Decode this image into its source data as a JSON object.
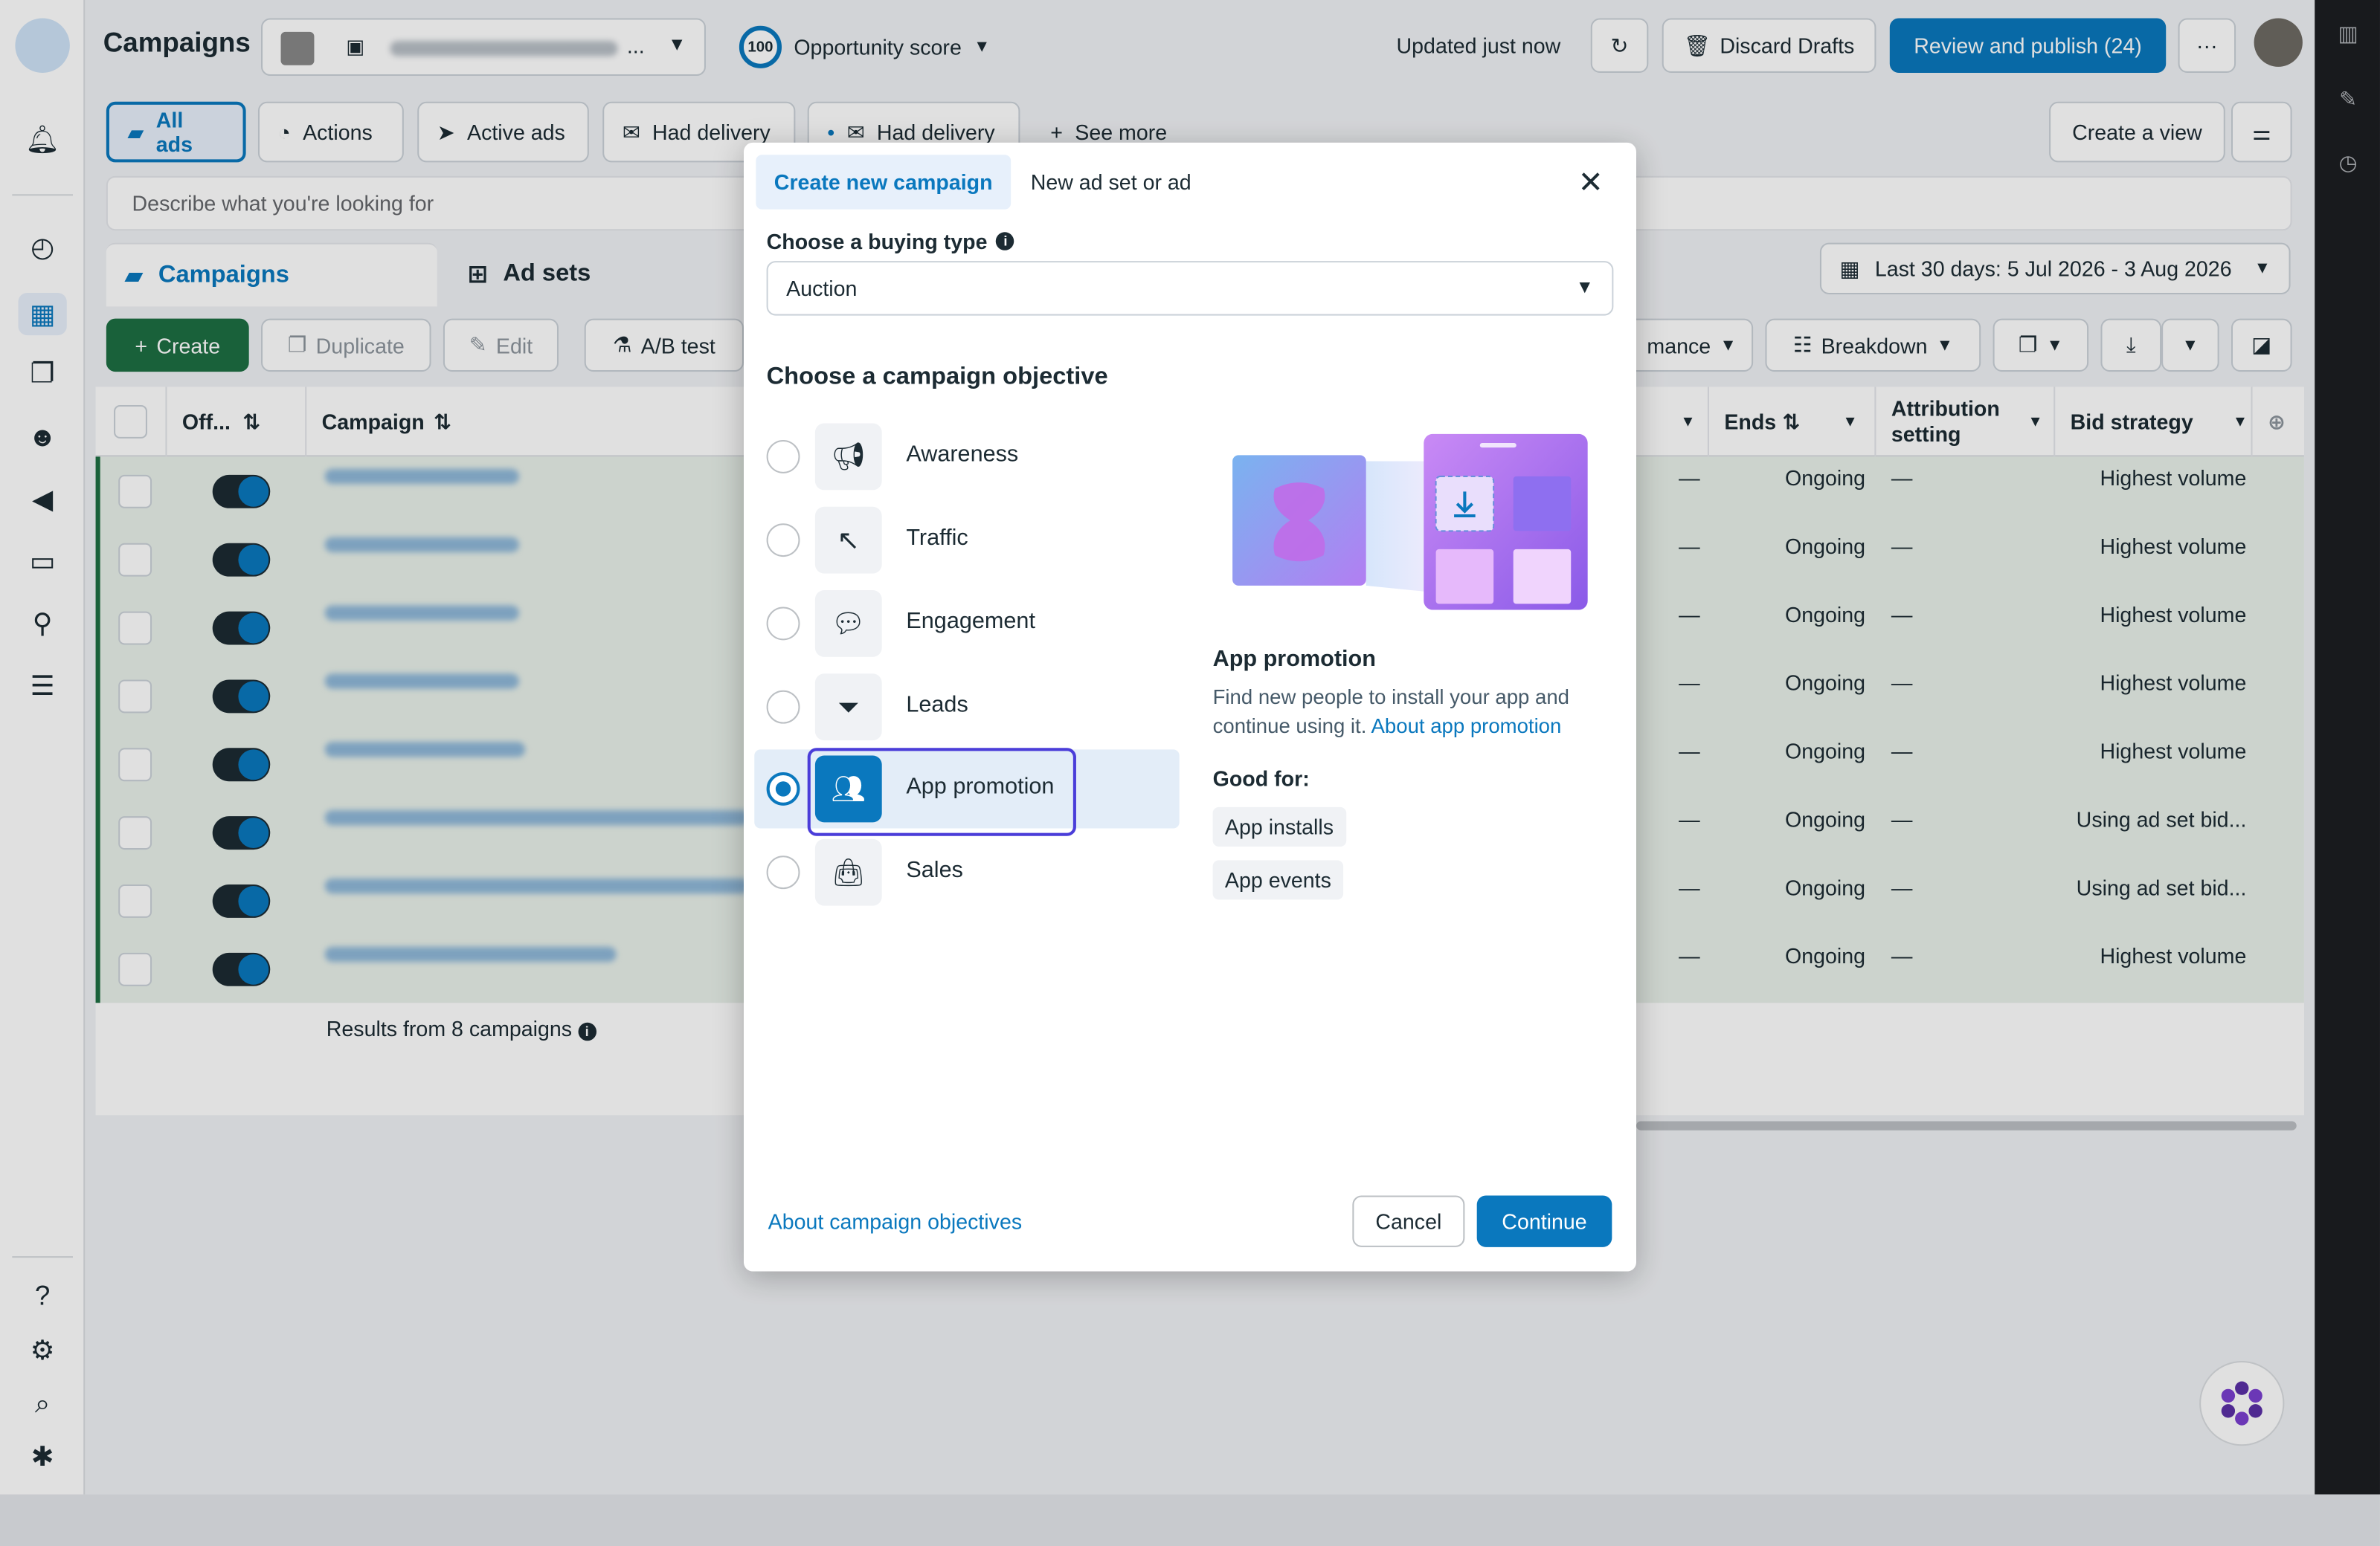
{
  "header": {
    "title": "Campaigns",
    "account_ellipsis": "...",
    "opportunity_badge": "100",
    "opportunity_label": "Opportunity score",
    "updated": "Updated just now",
    "discard_drafts": "Discard Drafts",
    "review_publish": "Review and publish (24)",
    "more": "···"
  },
  "filters": {
    "chips": [
      {
        "label": "All ads",
        "selected": true
      },
      {
        "label": "Actions"
      },
      {
        "label": "Active ads"
      },
      {
        "label": "Had delivery"
      },
      {
        "label": "Had delivery"
      },
      {
        "label": "See more"
      }
    ],
    "create_view": "Create a view",
    "search_placeholder": "Describe what you're looking for"
  },
  "levels": {
    "campaigns": "Campaigns",
    "ad_sets": "Ad sets",
    "date_range": "Last 30 days: 5 Jul 2026 - 3 Aug 2026"
  },
  "toolbar": {
    "create": "Create",
    "duplicate": "Duplicate",
    "edit": "Edit",
    "ab_test": "A/B test",
    "performance_partial": "mance",
    "breakdown": "Breakdown"
  },
  "table": {
    "headers": {
      "off": "Off...",
      "campaign": "Campaign",
      "ends": "Ends",
      "attribution": "Attribution setting",
      "bid_strategy": "Bid strategy"
    },
    "rows": [
      {
        "ends": "Ongoing",
        "dash": "—",
        "bid": "Highest volume"
      },
      {
        "ends": "Ongoing",
        "dash": "—",
        "bid": "Highest volume"
      },
      {
        "ends": "Ongoing",
        "dash": "—",
        "bid": "Highest volume"
      },
      {
        "ends": "Ongoing",
        "dash": "—",
        "bid": "Highest volume"
      },
      {
        "ends": "Ongoing",
        "dash": "—",
        "bid": "Highest volume"
      },
      {
        "ends": "Ongoing",
        "dash": "—",
        "bid": "Using ad set bid..."
      },
      {
        "ends": "Ongoing",
        "dash": "—",
        "bid": "Using ad set bid..."
      },
      {
        "ends": "Ongoing",
        "dash": "—",
        "bid": "Highest volume"
      }
    ],
    "results": "Results from 8 campaigns"
  },
  "modal": {
    "tab_new_campaign": "Create new campaign",
    "tab_new_adset": "New ad set or ad",
    "buying_type_label": "Choose a buying type",
    "buying_type_value": "Auction",
    "objective_heading": "Choose a campaign objective",
    "objectives": [
      {
        "label": "Awareness",
        "icon": "megaphone-icon"
      },
      {
        "label": "Traffic",
        "icon": "cursor-icon"
      },
      {
        "label": "Engagement",
        "icon": "chat-icon"
      },
      {
        "label": "Leads",
        "icon": "funnel-icon"
      },
      {
        "label": "App promotion",
        "icon": "people-icon",
        "selected": true
      },
      {
        "label": "Sales",
        "icon": "shopping-bag-icon"
      }
    ],
    "detail_title": "App promotion",
    "detail_text": "Find new people to install your app and continue using it.",
    "detail_link": "About app promotion",
    "good_for_label": "Good for:",
    "good_for": [
      "App installs",
      "App events"
    ],
    "about_link": "About campaign objectives",
    "cancel": "Cancel",
    "continue": "Continue"
  },
  "colors": {
    "accent": "#0a78be",
    "create_green": "#1d6f42",
    "focus_ring": "#4a3dd9"
  }
}
